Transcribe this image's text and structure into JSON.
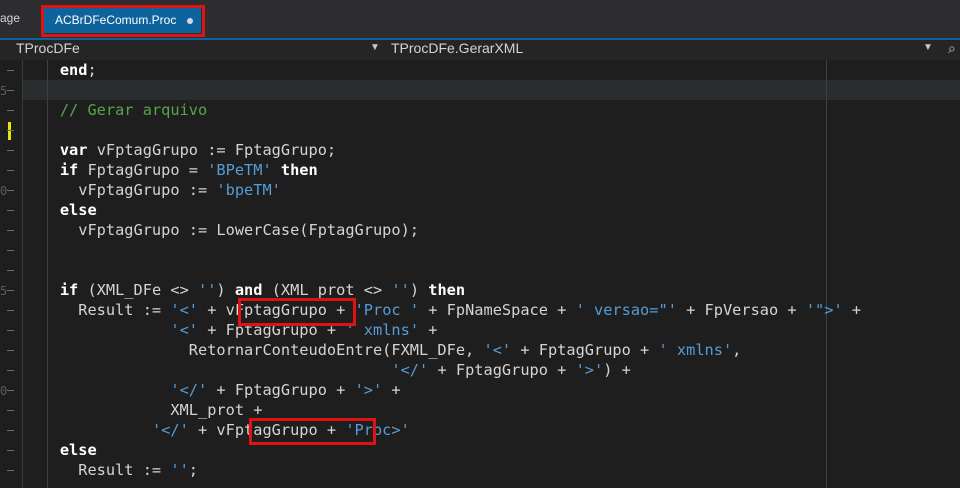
{
  "tabs": {
    "previous_label": "age",
    "active_label": "ACBrDFeComum.Proc"
  },
  "navbar": {
    "left_label": "TProcDFe",
    "right_label": "TProcDFe.GerarXML",
    "dropdown_glyph": "▼",
    "search_glyph": "⌕"
  },
  "gutter": {
    "numbers": [
      "5",
      "0",
      "5",
      "0"
    ]
  },
  "code": {
    "lines": [
      [
        {
          "t": "    "
        },
        {
          "c": "kw",
          "t": "end"
        },
        {
          "t": ";"
        }
      ],
      [
        {
          "t": ""
        }
      ],
      [
        {
          "t": "    "
        },
        {
          "c": "cm",
          "t": "// Gerar arquivo"
        }
      ],
      [
        {
          "t": ""
        }
      ],
      [
        {
          "t": "    "
        },
        {
          "c": "kw",
          "t": "var"
        },
        {
          "t": " vFptagGrupo := FptagGrupo;"
        }
      ],
      [
        {
          "t": "    "
        },
        {
          "c": "kw",
          "t": "if"
        },
        {
          "t": " FptagGrupo = "
        },
        {
          "c": "str",
          "t": "'BPeTM'"
        },
        {
          "t": " "
        },
        {
          "c": "kw",
          "t": "then"
        }
      ],
      [
        {
          "t": "      vFptagGrupo := "
        },
        {
          "c": "str",
          "t": "'bpeTM'"
        }
      ],
      [
        {
          "t": "    "
        },
        {
          "c": "kw",
          "t": "else"
        }
      ],
      [
        {
          "t": "      vFptagGrupo := LowerCase(FptagGrupo);"
        }
      ],
      [
        {
          "t": ""
        }
      ],
      [
        {
          "t": ""
        }
      ],
      [
        {
          "t": "    "
        },
        {
          "c": "kw",
          "t": "if"
        },
        {
          "t": " (XML_DFe <> "
        },
        {
          "c": "str",
          "t": "''"
        },
        {
          "t": ") "
        },
        {
          "c": "kw",
          "t": "and"
        },
        {
          "t": " (XML_prot <> "
        },
        {
          "c": "str",
          "t": "''"
        },
        {
          "t": ") "
        },
        {
          "c": "kw",
          "t": "then"
        }
      ],
      [
        {
          "t": "      Result := "
        },
        {
          "c": "str",
          "t": "'<'"
        },
        {
          "t": " + vFptagGrupo + "
        },
        {
          "c": "str",
          "t": "'Proc '"
        },
        {
          "t": " + FpNameSpace + "
        },
        {
          "c": "str",
          "t": "' versao=\"'"
        },
        {
          "t": " + FpVersao + "
        },
        {
          "c": "str",
          "t": "'\">'"
        },
        {
          "t": " +"
        }
      ],
      [
        {
          "t": "                "
        },
        {
          "c": "str",
          "t": "'<'"
        },
        {
          "t": " + FptagGrupo + "
        },
        {
          "c": "str",
          "t": "' xmlns'"
        },
        {
          "t": " +"
        }
      ],
      [
        {
          "t": "                  RetornarConteudoEntre(FXML_DFe, "
        },
        {
          "c": "str",
          "t": "'<'"
        },
        {
          "t": " + FptagGrupo + "
        },
        {
          "c": "str",
          "t": "' xmlns'"
        },
        {
          "t": ","
        }
      ],
      [
        {
          "t": "                                        "
        },
        {
          "c": "str",
          "t": "'</'"
        },
        {
          "t": " + FptagGrupo + "
        },
        {
          "c": "str",
          "t": "'>'"
        },
        {
          "t": ") +"
        }
      ],
      [
        {
          "t": "                "
        },
        {
          "c": "str",
          "t": "'</'"
        },
        {
          "t": " + FptagGrupo + "
        },
        {
          "c": "str",
          "t": "'>'"
        },
        {
          "t": " +"
        }
      ],
      [
        {
          "t": "                XML_prot +"
        }
      ],
      [
        {
          "t": "              "
        },
        {
          "c": "str",
          "t": "'</'"
        },
        {
          "t": " + vFptagGrupo + "
        },
        {
          "c": "str",
          "t": "'Proc>'"
        }
      ],
      [
        {
          "t": "    "
        },
        {
          "c": "kw",
          "t": "else"
        }
      ],
      [
        {
          "t": "      Result := "
        },
        {
          "c": "str",
          "t": "''"
        },
        {
          "t": ";"
        }
      ]
    ]
  }
}
